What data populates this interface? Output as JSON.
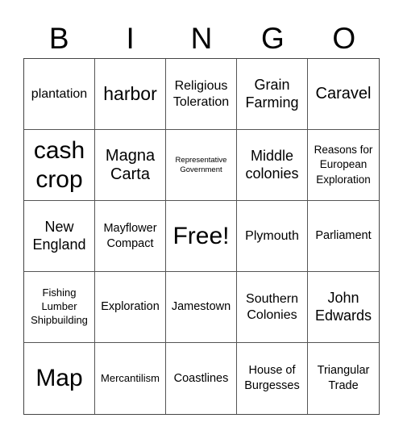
{
  "header": {
    "letters": [
      "B",
      "I",
      "N",
      "G",
      "O"
    ]
  },
  "board": {
    "rows": [
      [
        "plantation",
        "harbor",
        "Religious Toleration",
        "Grain Farming",
        "Caravel"
      ],
      [
        "cash crop",
        "Magna Carta",
        "Representative Government",
        "Middle colonies",
        "Reasons for European Exploration"
      ],
      [
        "New England",
        "Mayflower Compact",
        "Free!",
        "Plymouth",
        "Parliament"
      ],
      [
        "Fishing Lumber Shipbuilding",
        "Exploration",
        "Jamestown",
        "Southern Colonies",
        "John Edwards"
      ],
      [
        "Map",
        "Mercantilism",
        "Coastlines",
        "House of Burgesses",
        "Triangular Trade"
      ]
    ],
    "free_space": "Free!"
  },
  "colors": {
    "grid_line": "#555555",
    "text": "#000000",
    "background": "#ffffff"
  }
}
